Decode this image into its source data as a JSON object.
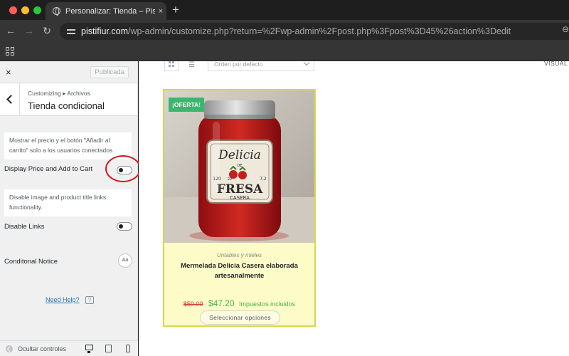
{
  "browser": {
    "tab_title": "Personalizar: Tienda – Pistifiur",
    "tab_close": "×",
    "new_tab": "+",
    "url_host": "pistifiur.com",
    "url_path": "/wp-admin/customize.php?return=%2Fwp-admin%2Fpost.php%3Fpost%3D45%26action%3Dedit"
  },
  "sidebar": {
    "close": "×",
    "publish_label": "Publicada",
    "breadcrumb": "Customizing ▸ Archivos",
    "section_title": "Tienda condicional",
    "description_price": "Mostrar el precio y el botón \"Añadir al carrito\" solo a los usuarios conectados",
    "control_price_label": "Display Price and Add to Cart",
    "description_links": "Disable image and product title links functionality.",
    "control_links_label": "Disable Links",
    "control_notice_label": "Conditonal Notice",
    "font_button_label": "Aa",
    "help_link": "Need Help?",
    "help_icon": "?",
    "collapse_label": "Ocultar controles"
  },
  "preview": {
    "sort_label": "Orden por defecto",
    "visual_label": "VISUAL",
    "list_icon": "☰",
    "product": {
      "badge": "¡OFERTA!",
      "category": "Untables y mieles",
      "title": "Mermelada Delicia Casera elaborada artesanalmente",
      "old_price": "$59.00",
      "price": "$47.20",
      "tax_note": "Impuestos incluidos",
      "button": "Seleccionar opciones",
      "label_line1": "Delicia",
      "label_line2": "DE",
      "label_line3": "FRESA",
      "label_line4": "CASERA",
      "label_left": "120",
      "label_mid": "22",
      "label_right": "7,2"
    }
  },
  "colors": {
    "accent_link": "#2271b1",
    "sale_badge": "#3bb66e",
    "sale_price": "#46b450",
    "old_price": "#d63638",
    "card_border": "#d6d84e",
    "annotation": "#d4141e"
  }
}
